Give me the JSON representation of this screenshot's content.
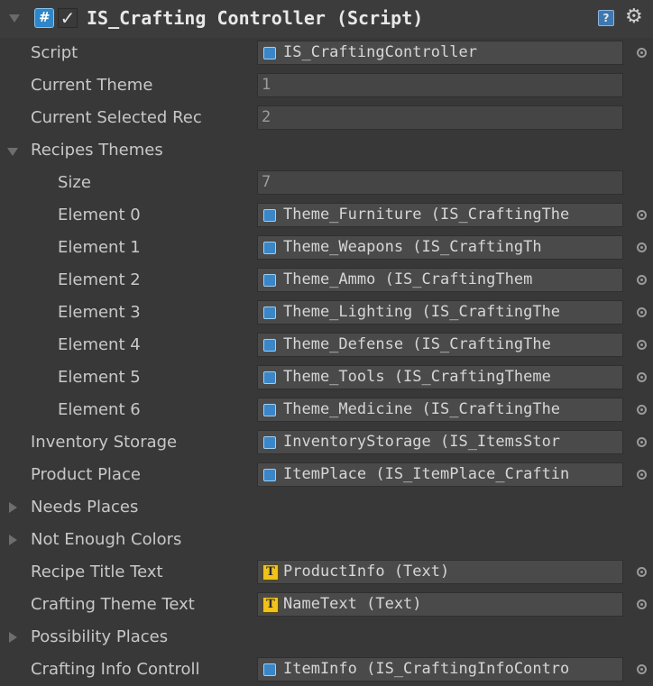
{
  "component": {
    "title": "IS_Crafting Controller (Script)",
    "enabled_mark": "✓"
  },
  "fields": {
    "script": {
      "label": "Script",
      "value": "IS_CraftingController"
    },
    "current_theme": {
      "label": "Current Theme",
      "value": "1"
    },
    "current_selected_rec": {
      "label": "Current Selected Rec",
      "value": "2"
    },
    "recipes_themes": {
      "label": "Recipes Themes",
      "size_label": "Size",
      "size_value": "7",
      "elements": [
        {
          "label": "Element 0",
          "value": "Theme_Furniture (IS_CraftingThe"
        },
        {
          "label": "Element 1",
          "value": "Theme_Weapons (IS_CraftingTh"
        },
        {
          "label": "Element 2",
          "value": "Theme_Ammo (IS_CraftingThem"
        },
        {
          "label": "Element 3",
          "value": "Theme_Lighting (IS_CraftingThe"
        },
        {
          "label": "Element 4",
          "value": "Theme_Defense (IS_CraftingThe"
        },
        {
          "label": "Element 5",
          "value": "Theme_Tools (IS_CraftingTheme"
        },
        {
          "label": "Element 6",
          "value": "Theme_Medicine (IS_CraftingThe"
        }
      ]
    },
    "inventory_storage": {
      "label": "Inventory Storage",
      "value": "InventoryStorage (IS_ItemsStor"
    },
    "product_place": {
      "label": "Product Place",
      "value": "ItemPlace (IS_ItemPlace_Craftin"
    },
    "needs_places": {
      "label": "Needs Places"
    },
    "not_enough_colors": {
      "label": "Not Enough Colors"
    },
    "recipe_title_text": {
      "label": "Recipe Title Text",
      "value": "ProductInfo (Text)"
    },
    "crafting_theme_text": {
      "label": "Crafting Theme Text",
      "value": "NameText (Text)"
    },
    "possibility_places": {
      "label": "Possibility Places"
    },
    "crafting_info_controller": {
      "label": "Crafting Info Controll",
      "value": "ItemInfo (IS_CraftingInfoContro"
    }
  },
  "icons": {
    "help": "?",
    "gear": "⚙",
    "text_component": "T"
  }
}
